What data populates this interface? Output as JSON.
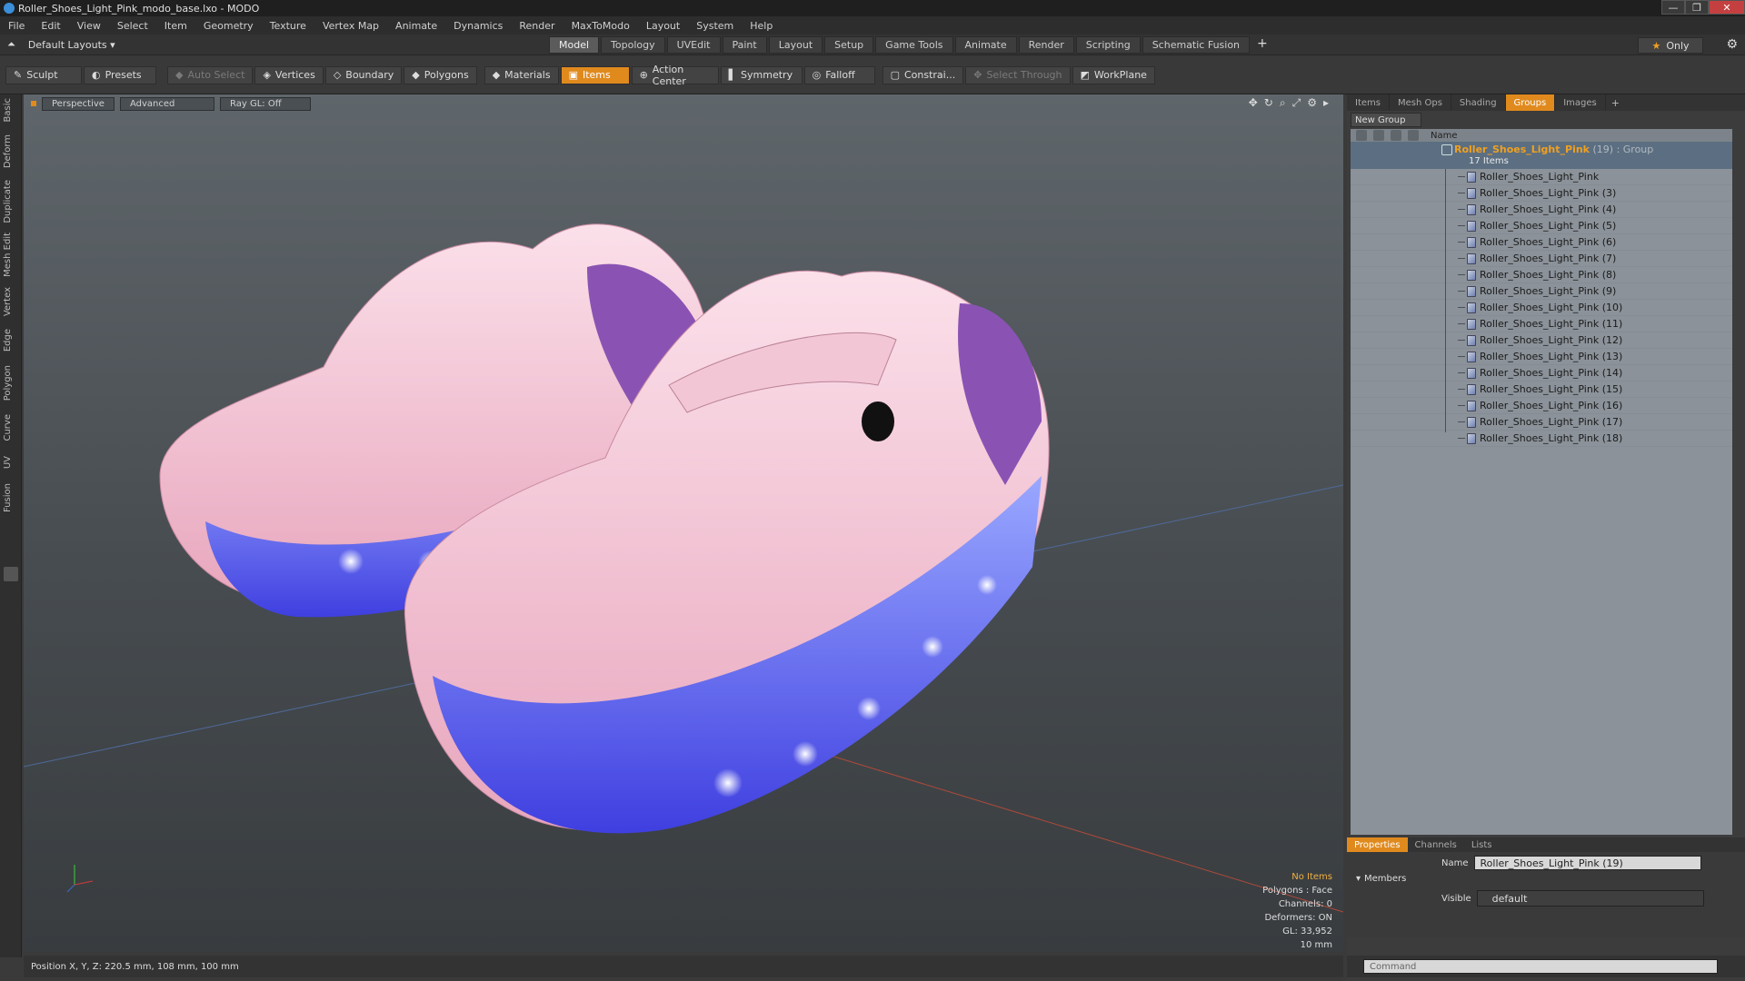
{
  "window": {
    "title": "Roller_Shoes_Light_Pink_modo_base.lxo - MODO"
  },
  "menu": [
    "File",
    "Edit",
    "View",
    "Select",
    "Item",
    "Geometry",
    "Texture",
    "Vertex Map",
    "Animate",
    "Dynamics",
    "Render",
    "MaxToModo",
    "Layout",
    "System",
    "Help"
  ],
  "layouts": {
    "label": "Default Layouts ▾"
  },
  "mode_tabs": [
    "Model",
    "Topology",
    "UVEdit",
    "Paint",
    "Layout",
    "Setup",
    "Game Tools",
    "Animate",
    "Render",
    "Scripting",
    "Schematic Fusion"
  ],
  "only_button": "Only",
  "toolbar": {
    "sculpt": "Sculpt",
    "presets": "Presets",
    "auto_select": "Auto Select",
    "vertices": "Vertices",
    "boundary": "Boundary",
    "polygons": "Polygons",
    "materials": "Materials",
    "items": "Items",
    "action_center": "Action Center",
    "symmetry": "Symmetry",
    "falloff": "Falloff",
    "constraints": "Constrai...",
    "select_through": "Select Through",
    "workplane": "WorkPlane"
  },
  "left_tabs": [
    "Basic",
    "Deform",
    "Duplicate",
    "Mesh Edit",
    "Vertex",
    "Edge",
    "Polygon",
    "Curve",
    "UV",
    "Fusion"
  ],
  "viewport": {
    "tabs": [
      "Perspective",
      "Advanced",
      "Ray GL: Off"
    ],
    "status": {
      "items": "No Items",
      "polygons": "Polygons : Face",
      "channels": "Channels: 0",
      "deformers": "Deformers: ON",
      "gl": "GL: 33,952",
      "scale": "10 mm"
    }
  },
  "position_readout": "Position X, Y, Z:   220.5 mm, 108 mm, 100 mm",
  "right_panel": {
    "tabs": [
      "Items",
      "Mesh Ops",
      "Shading",
      "Groups",
      "Images"
    ],
    "active_tab": "Groups",
    "new_group": "New Group",
    "column_name": "Name",
    "group": {
      "name": "Roller_Shoes_Light_Pink",
      "type": " (19) : Group",
      "count": "17 Items"
    },
    "items": [
      "Roller_Shoes_Light_Pink",
      "Roller_Shoes_Light_Pink (3)",
      "Roller_Shoes_Light_Pink (4)",
      "Roller_Shoes_Light_Pink (5)",
      "Roller_Shoes_Light_Pink (6)",
      "Roller_Shoes_Light_Pink (7)",
      "Roller_Shoes_Light_Pink (8)",
      "Roller_Shoes_Light_Pink (9)",
      "Roller_Shoes_Light_Pink (10)",
      "Roller_Shoes_Light_Pink (11)",
      "Roller_Shoes_Light_Pink (12)",
      "Roller_Shoes_Light_Pink (13)",
      "Roller_Shoes_Light_Pink (14)",
      "Roller_Shoes_Light_Pink (15)",
      "Roller_Shoes_Light_Pink (16)",
      "Roller_Shoes_Light_Pink (17)",
      "Roller_Shoes_Light_Pink (18)"
    ],
    "props_tabs": [
      "Properties",
      "Channels",
      "Lists"
    ],
    "name_label": "Name",
    "name_value": "Roller_Shoes_Light_Pink (19)",
    "members_label": "Members",
    "visible_label": "Visible",
    "visible_value": "default",
    "command_placeholder": "Command"
  },
  "colors": {
    "accent": "#e08a1e",
    "group_text": "#f0a020"
  }
}
